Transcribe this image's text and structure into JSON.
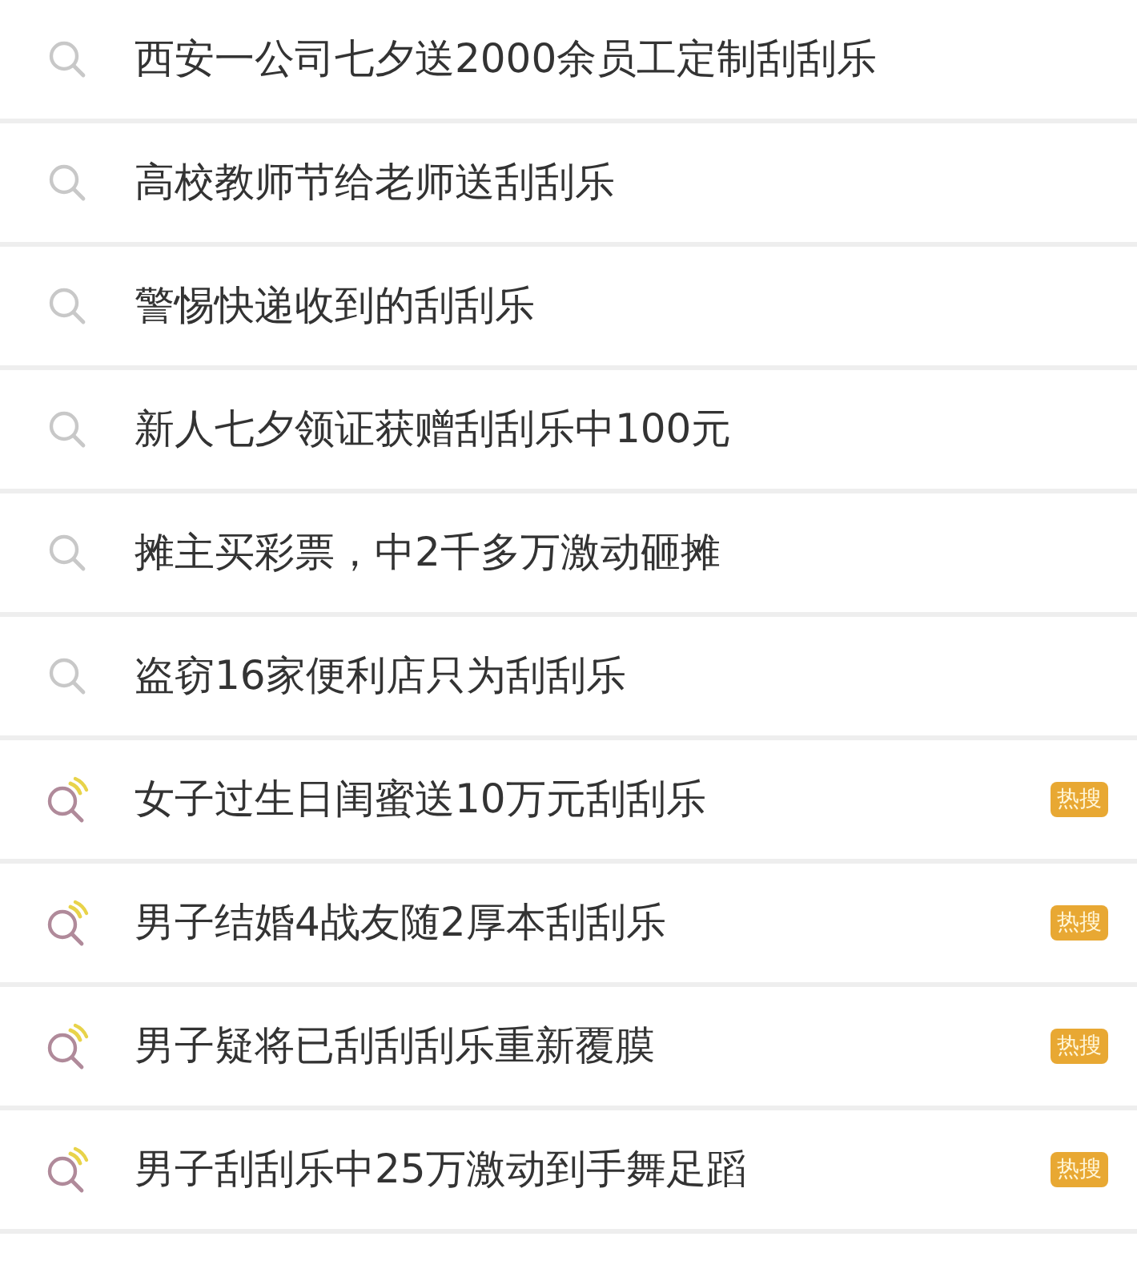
{
  "suggestions": [
    {
      "text": "西安一公司七夕送2000余员工定制刮刮乐",
      "kind": "normal"
    },
    {
      "text": "高校教师节给老师送刮刮乐",
      "kind": "normal"
    },
    {
      "text": "警惕快递收到的刮刮乐",
      "kind": "normal"
    },
    {
      "text": "新人七夕领证获赠刮刮乐中100元",
      "kind": "normal"
    },
    {
      "text": "摊主买彩票，中2千多万激动砸摊",
      "kind": "normal"
    },
    {
      "text": "盗窃16家便利店只为刮刮乐",
      "kind": "normal"
    },
    {
      "text": "女子过生日闺蜜送10万元刮刮乐",
      "kind": "hot",
      "badge": "热搜"
    },
    {
      "text": "男子结婚4战友随2厚本刮刮乐",
      "kind": "hot",
      "badge": "热搜"
    },
    {
      "text": "男子疑将已刮刮刮乐重新覆膜",
      "kind": "hot",
      "badge": "热搜"
    },
    {
      "text": "男子刮刮乐中25万激动到手舞足蹈",
      "kind": "hot",
      "badge": "热搜"
    }
  ]
}
